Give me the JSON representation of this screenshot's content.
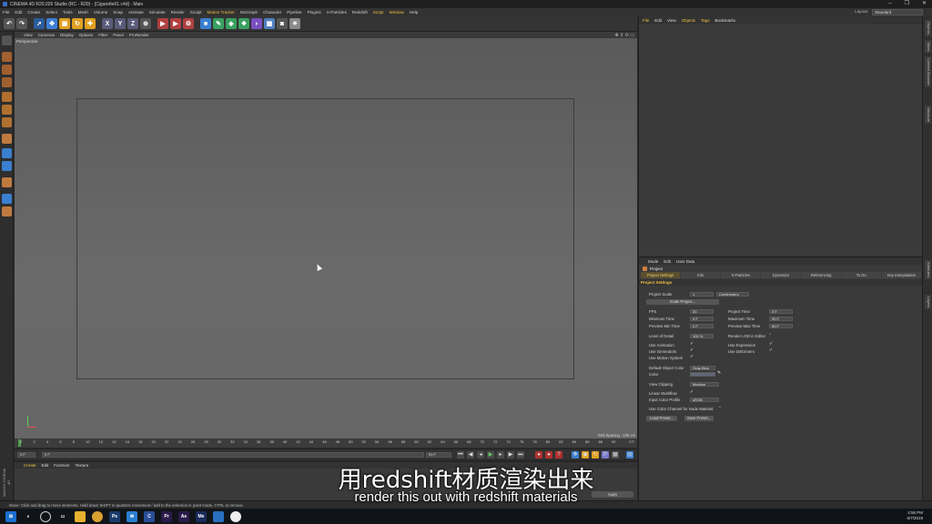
{
  "window": {
    "title": "CINEMA 4D R20.026 Studio (RC - R20) - [Cigarette01.c4d] - Main",
    "controls": [
      "–",
      "❐",
      "✕"
    ]
  },
  "menubar": {
    "items": [
      "File",
      "Edit",
      "Create",
      "Select",
      "Tools",
      "Mesh",
      "Volume",
      "Snap",
      "Animate",
      "Simulate",
      "Render",
      "Sculpt",
      "Motion Tracker",
      "MoGraph",
      "Character",
      "Pipeline",
      "Plugins",
      "X-Particles",
      "Redshift",
      "Script",
      "Window",
      "Help"
    ],
    "layout_label": "Layout:",
    "layout_value": "Standard"
  },
  "toolbar": {
    "axis_x": "X",
    "axis_y": "Y",
    "axis_z": "Z"
  },
  "viewport": {
    "menu": [
      "View",
      "Cameras",
      "Display",
      "Options",
      "Filter",
      "Panel",
      "ProRender"
    ],
    "label": "Perspective",
    "grid_spacing": "Grid Spacing : 100 cm"
  },
  "timeline": {
    "ticks": [
      "0",
      "2",
      "4",
      "6",
      "8",
      "10",
      "12",
      "14",
      "16",
      "18",
      "20",
      "22",
      "24",
      "26",
      "28",
      "30",
      "32",
      "34",
      "36",
      "38",
      "40",
      "42",
      "44",
      "46",
      "48",
      "50",
      "52",
      "54",
      "56",
      "58",
      "60",
      "62",
      "64",
      "66",
      "68",
      "70",
      "72",
      "74",
      "76",
      "78",
      "80",
      "82",
      "84",
      "86",
      "88",
      "90"
    ],
    "end_label": "0 F",
    "start_frame": "0 F",
    "min_frame": "0 F",
    "max_frame": "90 F",
    "preview_max": "90 F"
  },
  "material_manager": {
    "menu": [
      "Create",
      "Edit",
      "Function",
      "Texture"
    ],
    "apply_label": "Apply",
    "side_logo": "MAXON CINEMA 4D"
  },
  "statusbar": {
    "text": "Move: Click and drag to move elements. Hold down SHIFT to quantize movement / add to the selection in point mode, CTRL to remove."
  },
  "object_manager": {
    "menu": [
      "File",
      "Edit",
      "View",
      "Objects",
      "Tags",
      "Bookmarks"
    ]
  },
  "right_strip": {
    "tabs": [
      "Objects",
      "Takes",
      "Content Browser",
      "Structure",
      "Attributes",
      "Layers"
    ]
  },
  "attributes": {
    "menu": [
      "Mode",
      "Edit",
      "User Data"
    ],
    "title": "Project",
    "tabs": [
      "Project Settings",
      "Info",
      "X-Particles",
      "Dynamics",
      "Referencing",
      "To Do",
      "Key Interpolation"
    ],
    "section": "Project Settings",
    "project_scale_label": "Project Scale",
    "project_scale_value": "1",
    "project_scale_unit": "Centimeters",
    "scale_project_btn": "Scale Project...",
    "fps_label": "FPS",
    "fps_value": "30",
    "project_time_label": "Project Time",
    "project_time_value": "0 F",
    "min_time_label": "Minimum Time",
    "min_time_value": "0 F",
    "max_time_label": "Maximum Time",
    "max_time_value": "90 F",
    "prev_min_label": "Preview Min Time",
    "prev_min_value": "0 F",
    "prev_max_label": "Preview Max Time",
    "prev_max_value": "90 F",
    "lod_label": "Level of Detail",
    "lod_value": "100 %",
    "render_lod_label": "Render LOD in Editor",
    "use_animation": "Use Animation",
    "use_expression": "Use Expression",
    "use_generators": "Use Generators",
    "use_deformers": "Use Deformers",
    "use_motion": "Use Motion System",
    "default_color_label": "Default Object Color",
    "default_color_value": "Gray-Blue",
    "color_label": "Color",
    "view_clipping_label": "View Clipping",
    "view_clipping_value": "Medium",
    "linear_workflow": "Linear Workflow",
    "input_profile_label": "Input Color Profile",
    "input_profile_value": "sRGB",
    "node_material": "Use Color Channel for Node Material",
    "load_preset": "Load Preset...",
    "save_preset": "Save Preset..."
  },
  "subtitles": {
    "chinese": "用redshift材质渲染出来",
    "english": "render this out with redshift materials"
  },
  "clock": {
    "time": "4:56 PM",
    "date": "6/7/2019"
  },
  "colors": {
    "accent": "#f0c040",
    "viewport_bg": "#616161"
  }
}
